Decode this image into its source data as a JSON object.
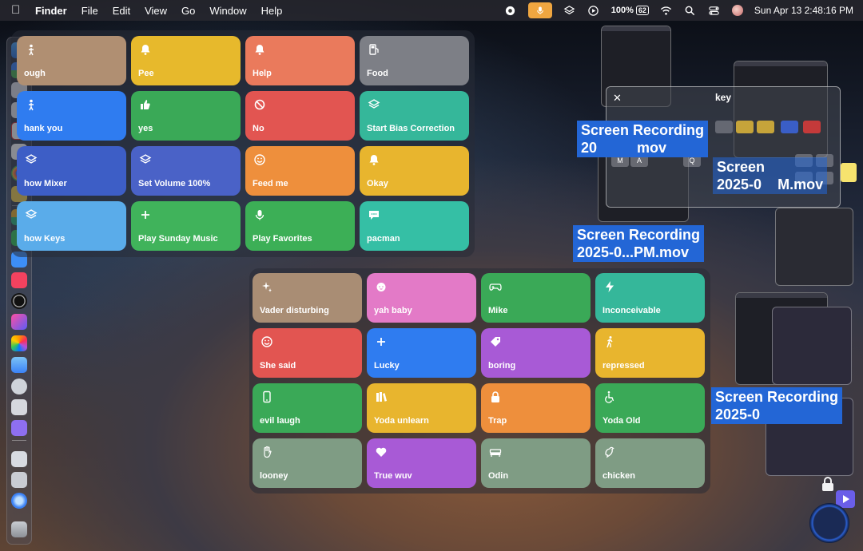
{
  "menubar": {
    "app_name": "Finder",
    "menus": [
      "File",
      "Edit",
      "View",
      "Go",
      "Window",
      "Help"
    ],
    "battery_percent": "100%",
    "battery_charge": "62",
    "datetime": "Sun Apr 13  2:48:16 PM"
  },
  "panel_top": [
    {
      "label": "ough",
      "color": "#b08f72",
      "icon": "figure-icon"
    },
    {
      "label": "Pee",
      "color": "#e7b92c",
      "icon": "bell-icon"
    },
    {
      "label": "Help",
      "color": "#ea7a5c",
      "icon": "bell-icon"
    },
    {
      "label": "Food",
      "color": "#7d7f86",
      "icon": "fuel-icon"
    },
    {
      "label": "hank you",
      "color": "#2f7cf0",
      "icon": "figure-icon"
    },
    {
      "label": "yes",
      "color": "#3aa957",
      "icon": "thumbs-up-icon"
    },
    {
      "label": "No",
      "color": "#e25551",
      "icon": "prohibited-icon"
    },
    {
      "label": "Start Bias Correction",
      "color": "#35b79a",
      "icon": "layers-icon"
    },
    {
      "label": "how Mixer",
      "color": "#3d5ec6",
      "icon": "layers-icon"
    },
    {
      "label": "Set Volume 100%",
      "color": "#4a62c7",
      "icon": "layers-icon"
    },
    {
      "label": "Feed me",
      "color": "#ee8f3c",
      "icon": "smile-icon"
    },
    {
      "label": "Okay",
      "color": "#e8b52e",
      "icon": "bell-icon"
    },
    {
      "label": "how Keys",
      "color": "#5aacea",
      "icon": "layers-icon"
    },
    {
      "label": "Play Sunday Music",
      "color": "#40b35b",
      "icon": "plus-icon"
    },
    {
      "label": "Play Favorites",
      "color": "#3caf56",
      "icon": "mic-icon"
    },
    {
      "label": "pacman",
      "color": "#35bfa5",
      "icon": "chat-icon"
    }
  ],
  "panel_bottom": [
    {
      "label": "Vader disturbing",
      "color": "#a98d74",
      "icon": "sparkle-icon"
    },
    {
      "label": "yah baby",
      "color": "#e37ac7",
      "icon": "baby-icon"
    },
    {
      "label": "Mike",
      "color": "#3aa957",
      "icon": "gamepad-icon"
    },
    {
      "label": "Inconceivable",
      "color": "#35b79a",
      "icon": "bolt-icon"
    },
    {
      "label": "She said",
      "color": "#e25551",
      "icon": "smile-icon"
    },
    {
      "label": "Lucky",
      "color": "#2f7cf0",
      "icon": "plus-icon"
    },
    {
      "label": "boring",
      "color": "#a85ad6",
      "icon": "tag-icon"
    },
    {
      "label": "repressed",
      "color": "#e8b52e",
      "icon": "walk-icon"
    },
    {
      "label": "evil laugh",
      "color": "#3aa957",
      "icon": "phone-icon"
    },
    {
      "label": "Yoda unlearn",
      "color": "#e8b52e",
      "icon": "books-icon"
    },
    {
      "label": "Trap",
      "color": "#ee8f3c",
      "icon": "lock-icon"
    },
    {
      "label": "Yoda Old",
      "color": "#3aa957",
      "icon": "wheelchair-icon"
    },
    {
      "label": "looney",
      "color": "#7f9c84",
      "icon": "hand-icon"
    },
    {
      "label": "True wuv",
      "color": "#a85ad6",
      "icon": "heart-icon"
    },
    {
      "label": "Odin",
      "color": "#7f9c84",
      "icon": "sofa-icon"
    },
    {
      "label": "chicken",
      "color": "#7f9c84",
      "icon": "bird-icon"
    }
  ],
  "recordings": {
    "label_a_line1": "Screen Recording",
    "label_a_line2": "20",
    "label_a_line2b": "mov",
    "label_b_line1": "Screen Recording",
    "label_b_line2": "2025-0...PM.mov",
    "label_c_line1": "Screen",
    "label_c_line2": "2025-0",
    "label_c_line2b": "M.mov",
    "label_d_line1": "Screen Recording",
    "label_d_line2": "2025-0"
  },
  "key_panel": {
    "title": "key",
    "keys_row1": [
      "M",
      "A"
    ],
    "keys_row2": [
      "Q"
    ]
  }
}
